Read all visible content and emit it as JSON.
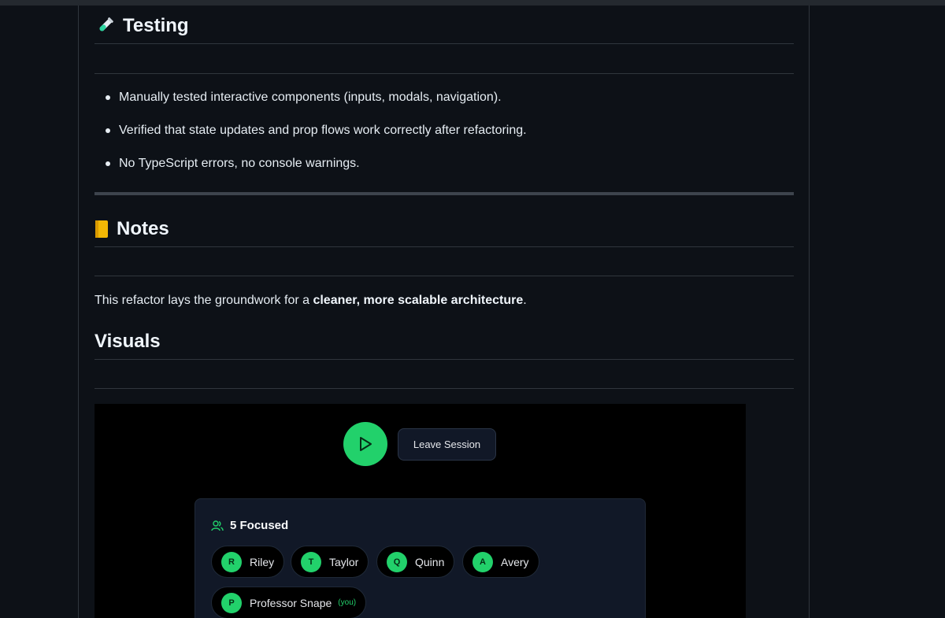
{
  "testing": {
    "title": "Testing",
    "items": [
      "Manually tested interactive components (inputs, modals, navigation).",
      "Verified that state updates and prop flows work correctly after refactoring.",
      "No TypeScript errors, no console warnings."
    ]
  },
  "notes": {
    "title": "Notes",
    "para_prefix": "This refactor lays the groundwork for a ",
    "para_bold": "cleaner, more scalable architecture",
    "para_suffix": "."
  },
  "visuals": {
    "title": "Visuals",
    "leave_label": "Leave Session",
    "focused_label": "5 Focused",
    "participants": [
      {
        "initial": "R",
        "name": "Riley"
      },
      {
        "initial": "T",
        "name": "Taylor"
      },
      {
        "initial": "Q",
        "name": "Quinn"
      },
      {
        "initial": "A",
        "name": "Avery"
      },
      {
        "initial": "P",
        "name": "Professor Snape",
        "tag": "(you)"
      }
    ],
    "accent": "#22d16b"
  }
}
